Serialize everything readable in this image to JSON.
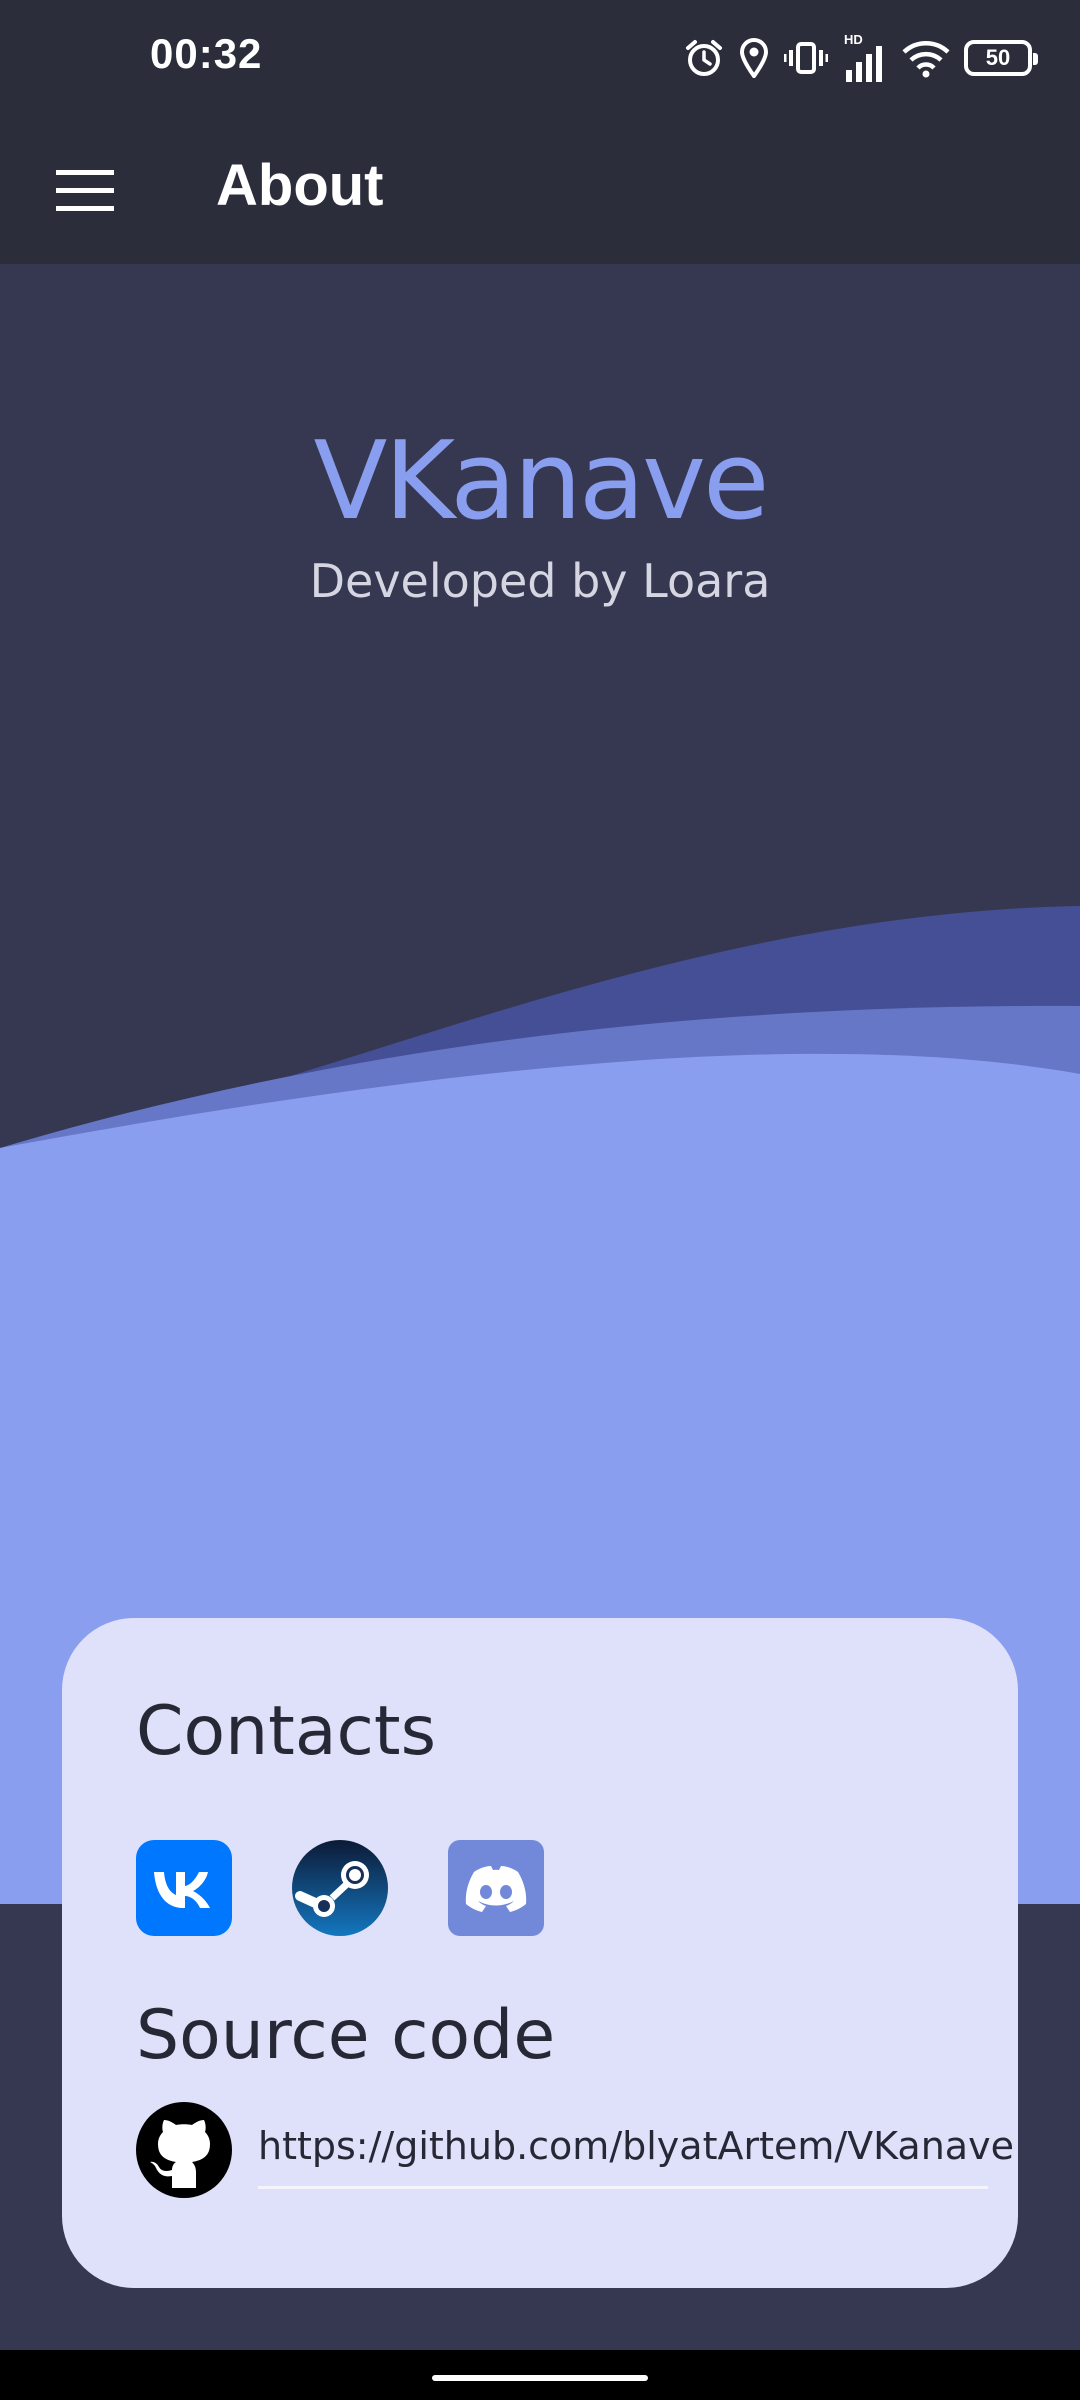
{
  "status_bar": {
    "time": "00:32",
    "network_badge": "HD",
    "battery_level": "50",
    "icons": [
      "alarm-icon",
      "location-icon",
      "vibrate-icon",
      "signal-icon",
      "wifi-icon",
      "battery-icon"
    ]
  },
  "toolbar": {
    "title": "About",
    "menu_icon": "hamburger-menu-icon"
  },
  "hero": {
    "app_name": "VKanave",
    "subtitle": "Developed by Loara"
  },
  "card": {
    "contacts_title": "Contacts",
    "contacts": [
      {
        "name": "vk",
        "icon": "vk-icon"
      },
      {
        "name": "steam",
        "icon": "steam-icon"
      },
      {
        "name": "discord",
        "icon": "discord-icon"
      }
    ],
    "source_title": "Source code",
    "source_icon": "github-icon",
    "repo_url": "https://github.com/blyatArtem/VKanave"
  },
  "colors": {
    "status_bar_bg": "#2b2d3b",
    "hero_bg": "#363852",
    "accent": "#8a9ef0",
    "card_bg": "#dfe0f9",
    "wave_dark": "#444f96",
    "wave_mid": "#6677c8",
    "vk_blue": "#0077ff",
    "discord": "#7289da"
  }
}
